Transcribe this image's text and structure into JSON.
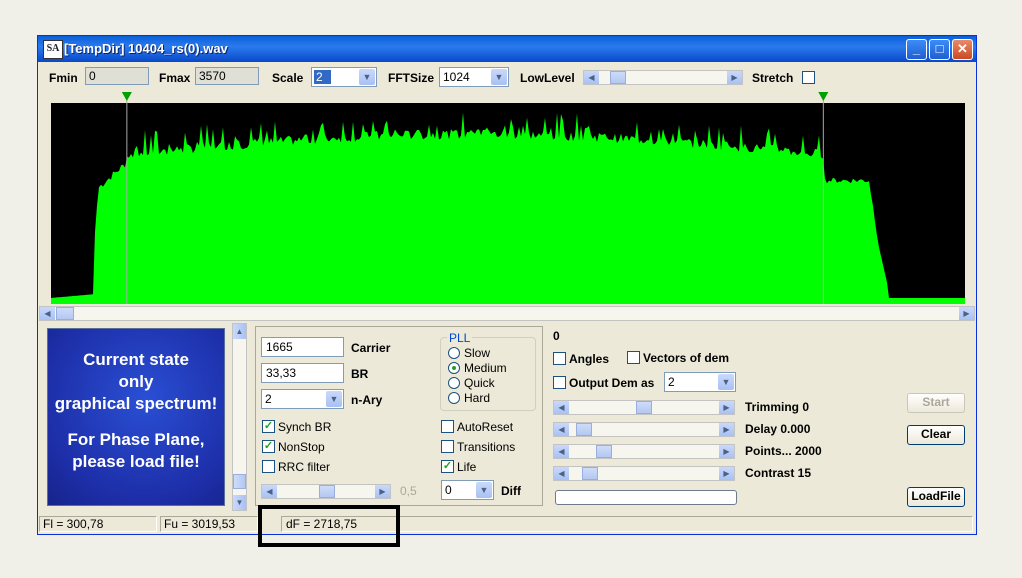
{
  "window": {
    "icon_text": "SA",
    "title": "[TempDir] 10404_rs(0).wav",
    "controls": {
      "minimize": "_",
      "maximize": "□",
      "close": "✕"
    }
  },
  "toolbar": {
    "fmin_label": "Fmin",
    "fmin_value": "0",
    "fmax_label": "Fmax",
    "fmax_value": "3570",
    "scale_label": "Scale",
    "scale_value": "2",
    "fftsize_label": "FFTSize",
    "fftsize_value": "1024",
    "lowlevel_label": "LowLevel",
    "lowlevel_position": 0.1,
    "stretch_label": "Stretch",
    "stretch_checked": false
  },
  "spectrum": {
    "background": "#000000",
    "fill_color": "#00ff00",
    "marker_color": "#00a000",
    "marker_left_frac": 0.083,
    "marker_right_frac": 0.845
  },
  "info_box": {
    "line1": "Current state",
    "line2": "only",
    "line3": "graphical spectrum!",
    "line4": "For Phase Plane,",
    "line5": "please load file!"
  },
  "params": {
    "carrier_value": "1665",
    "carrier_label": "Carrier",
    "br_value": "33,33",
    "br_label": "BR",
    "nary_value": "2",
    "nary_label": "n-Ary",
    "synch_br_label": "Synch BR",
    "synch_br_checked": true,
    "nonstop_label": "NonStop",
    "nonstop_checked": true,
    "rrc_label": "RRC filter",
    "rrc_checked": false,
    "slider_value_label": "0,5",
    "pll_title": "PLL",
    "pll_options": [
      "Slow",
      "Medium",
      "Quick",
      "Hard"
    ],
    "pll_selected": "Medium",
    "autoreset_label": "AutoReset",
    "autoreset_checked": false,
    "transitions_label": "Transitions",
    "transitions_checked": false,
    "life_label": "Life",
    "life_checked": true,
    "diff_value": "0",
    "diff_label": "Diff"
  },
  "demod": {
    "zero_label": "0",
    "angles_label": "Angles",
    "angles_checked": false,
    "vectors_label": "Vectors of dem",
    "vectors_checked": false,
    "output_label": "Output Dem as",
    "output_checked": false,
    "output_value": "2",
    "trimming_label": "Trimming 0",
    "trimming_position": 0.5,
    "delay_label": "Delay  0.000",
    "delay_position": 0.05,
    "points_label": "Points... 2000",
    "points_position": 0.2,
    "contrast_label": "Contrast 15",
    "contrast_position": 0.1,
    "start_label": "Start",
    "clear_label": "Clear",
    "loadfile_label": "LoadFile"
  },
  "status": {
    "fl": "Fl = 300,78",
    "fu": "Fu = 3019,53",
    "df": "dF = 2718,75"
  }
}
